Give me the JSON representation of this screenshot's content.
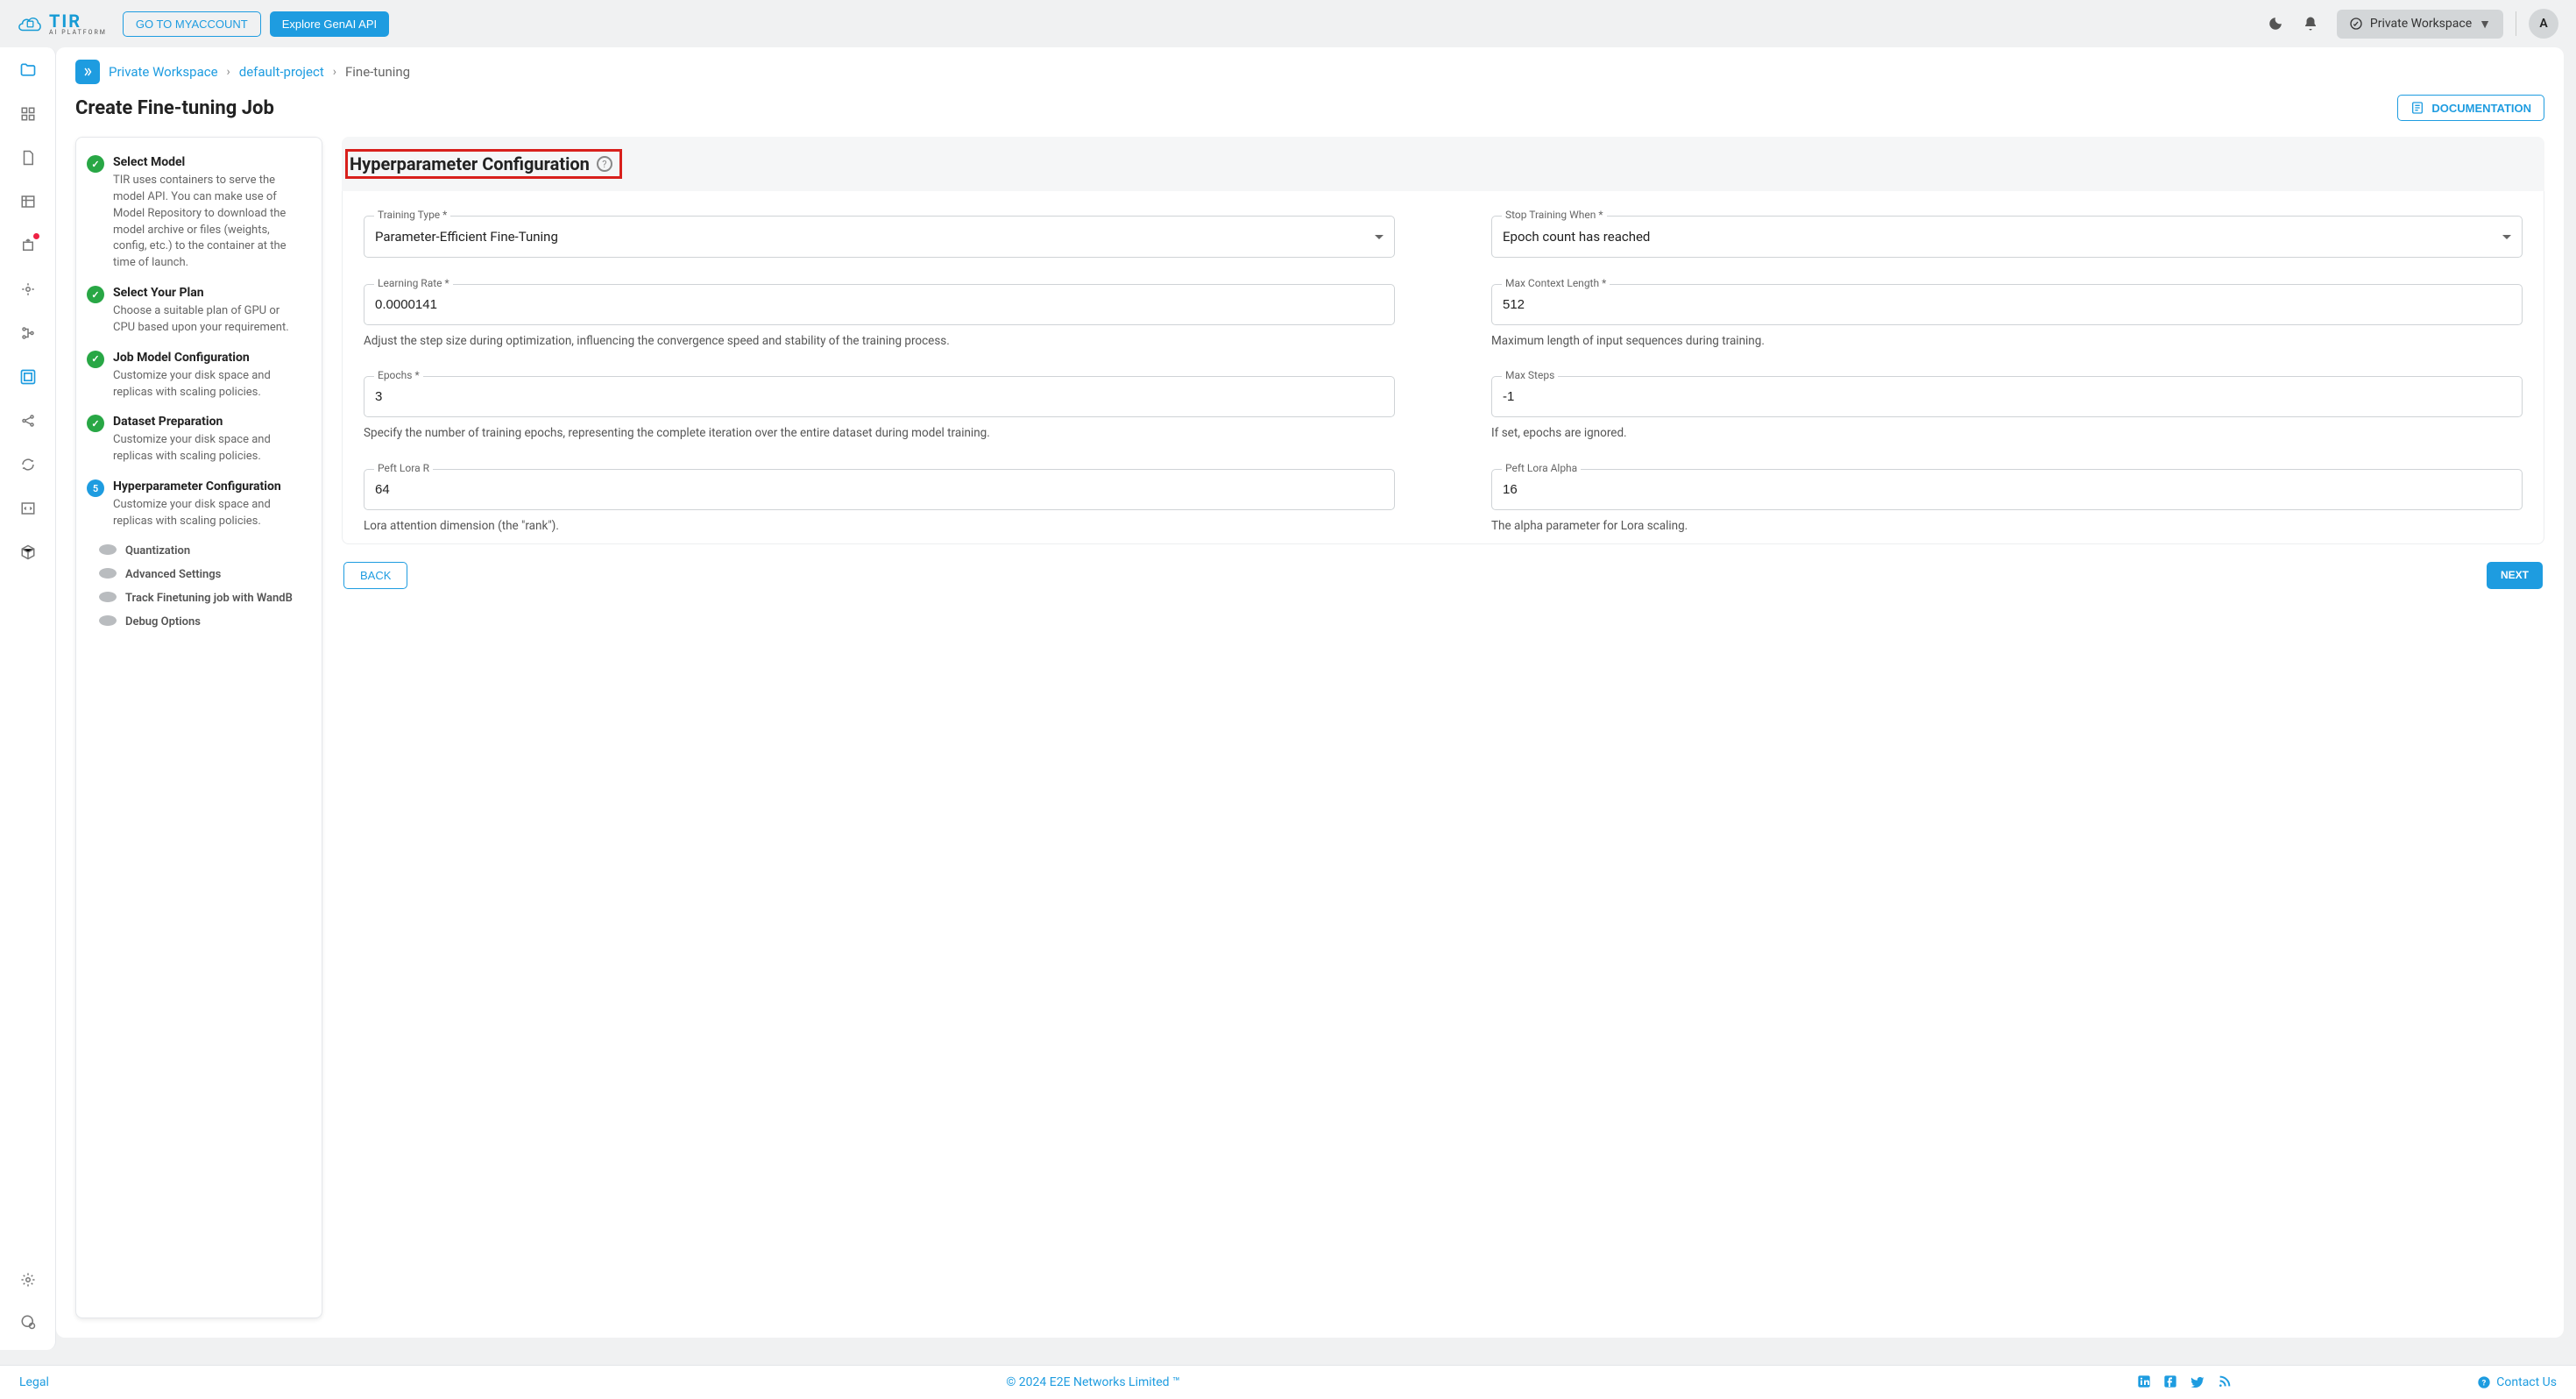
{
  "header": {
    "logo_main": "TIR",
    "logo_sub": "AI PLATFORM",
    "go_account": "GO TO MYACCOUNT",
    "explore": "Explore GenAI API",
    "workspace_label": "Private Workspace",
    "avatar_letter": "A"
  },
  "breadcrumb": {
    "a": "Private Workspace",
    "b": "default-project",
    "c": "Fine-tuning"
  },
  "page_title": "Create Fine-tuning Job",
  "doc_button": "DOCUMENTATION",
  "steps": [
    {
      "title": "Select Model",
      "desc": "TIR uses containers to serve the model API. You can make use of Model Repository to download the model archive or files (weights, config, etc.) to the container at the time of launch."
    },
    {
      "title": "Select Your Plan",
      "desc": "Choose a suitable plan of GPU or CPU based upon your requirement."
    },
    {
      "title": "Job Model Configuration",
      "desc": "Customize your disk space and replicas with scaling policies."
    },
    {
      "title": "Dataset Preparation",
      "desc": "Customize your disk space and replicas with scaling policies."
    },
    {
      "title": "Hyperparameter Configuration",
      "desc": "Customize your disk space and replicas with scaling policies.",
      "num": "5"
    }
  ],
  "substeps": [
    "Quantization",
    "Advanced Settings",
    "Track Finetuning job with WandB",
    "Debug Options"
  ],
  "form": {
    "heading": "Hyperparameter Configuration",
    "training_type": {
      "label": "Training Type",
      "value": "Parameter-Efficient Fine-Tuning"
    },
    "stop_when": {
      "label": "Stop Training When",
      "value": "Epoch count has reached"
    },
    "learning_rate": {
      "label": "Learning Rate",
      "value": "0.0000141",
      "help": "Adjust the step size during optimization, influencing the convergence speed and stability of the training process."
    },
    "max_context": {
      "label": "Max Context Length",
      "value": "512",
      "help": "Maximum length of input sequences during training."
    },
    "epochs": {
      "label": "Epochs",
      "value": "3",
      "help": "Specify the number of training epochs, representing the complete iteration over the entire dataset during model training."
    },
    "max_steps": {
      "label": "Max Steps",
      "value": "-1",
      "help": "If set, epochs are ignored."
    },
    "lora_r": {
      "label": "Peft Lora R",
      "value": "64",
      "help": "Lora attention dimension (the \"rank\")."
    },
    "lora_alpha": {
      "label": "Peft Lora Alpha",
      "value": "16",
      "help": "The alpha parameter for Lora scaling."
    },
    "back": "BACK",
    "next": "NEXT"
  },
  "footer": {
    "legal": "Legal",
    "copy": "© 2024 E2E Networks Limited ™",
    "contact": "Contact Us"
  }
}
